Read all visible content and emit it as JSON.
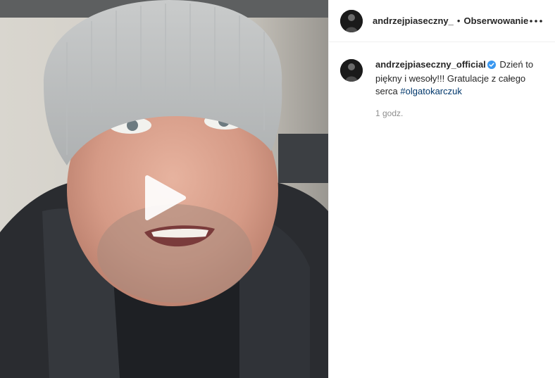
{
  "post": {
    "media": {
      "type": "video",
      "play_icon": "play-icon"
    },
    "header": {
      "username": "andrzejpiaseczny_",
      "separator": "•",
      "follow_label": "Obserwowanie",
      "more_icon": "more-horizontal-icon"
    },
    "caption": {
      "username": "andrzejpiaseczny_official",
      "verified_icon": "verified-badge-icon",
      "text": "Dzień to piękny i wesoły!!! Gratulacje z całego serca",
      "hashtag": "#olgatokarczuk",
      "timestamp": "1 godz."
    },
    "colors": {
      "verified": "#3897f0",
      "hashtag": "#00376b",
      "muted": "#8e8e8e"
    }
  }
}
